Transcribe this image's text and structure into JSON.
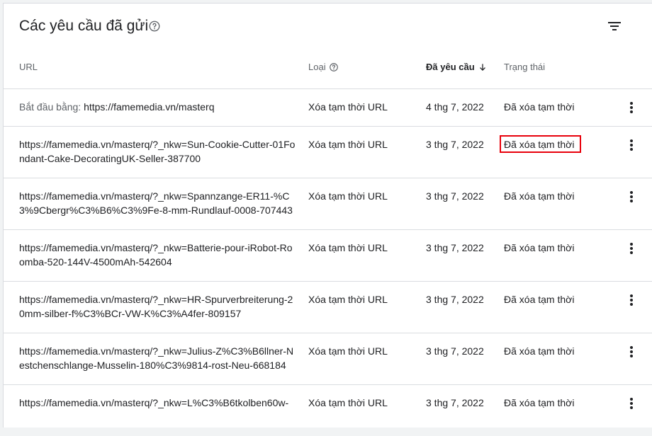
{
  "header": {
    "title": "Các yêu cầu đã gửi",
    "help_icon": "help-circle-icon",
    "filter_icon": "filter-list-icon"
  },
  "columns": {
    "url": "URL",
    "type": "Loại",
    "requested": "Đã yêu cầu",
    "status": "Trạng thái"
  },
  "rows": [
    {
      "prefix": "Bắt đầu bằng: ",
      "url": "https://famemedia.vn/masterq",
      "type": "Xóa tạm thời URL",
      "date": "4 thg 7, 2022",
      "status": "Đã xóa tạm thời"
    },
    {
      "prefix": "",
      "url": "https://famemedia.vn/masterq/?_nkw=Sun-Cookie-Cutter-01Fondant-Cake-DecoratingUK-Seller-387700",
      "type": "Xóa tạm thời URL",
      "date": "3 thg 7, 2022",
      "status": "Đã xóa tạm thời"
    },
    {
      "prefix": "",
      "url": "https://famemedia.vn/masterq/?_nkw=Spannzange-ER11-%C3%9Cbergr%C3%B6%C3%9Fe-8-mm-Rundlauf-0008-707443",
      "type": "Xóa tạm thời URL",
      "date": "3 thg 7, 2022",
      "status": "Đã xóa tạm thời"
    },
    {
      "prefix": "",
      "url": "https://famemedia.vn/masterq/?_nkw=Batterie-pour-iRobot-Roomba-520-144V-4500mAh-542604",
      "type": "Xóa tạm thời URL",
      "date": "3 thg 7, 2022",
      "status": "Đã xóa tạm thời"
    },
    {
      "prefix": "",
      "url": "https://famemedia.vn/masterq/?_nkw=HR-Spurverbreiterung-20mm-silber-f%C3%BCr-VW-K%C3%A4fer-809157",
      "type": "Xóa tạm thời URL",
      "date": "3 thg 7, 2022",
      "status": "Đã xóa tạm thời"
    },
    {
      "prefix": "",
      "url": "https://famemedia.vn/masterq/?_nkw=Julius-Z%C3%B6llner-Nestchenschlange-Musselin-180%C3%9814-rost-Neu-668184",
      "type": "Xóa tạm thời URL",
      "date": "3 thg 7, 2022",
      "status": "Đã xóa tạm thời"
    },
    {
      "prefix": "",
      "url": "https://famemedia.vn/masterq/?_nkw=L%C3%B6tkolben60w-",
      "type": "Xóa tạm thời URL",
      "date": "3 thg 7, 2022",
      "status": "Đã xóa tạm thời"
    }
  ],
  "highlight_color": "#e8000b"
}
